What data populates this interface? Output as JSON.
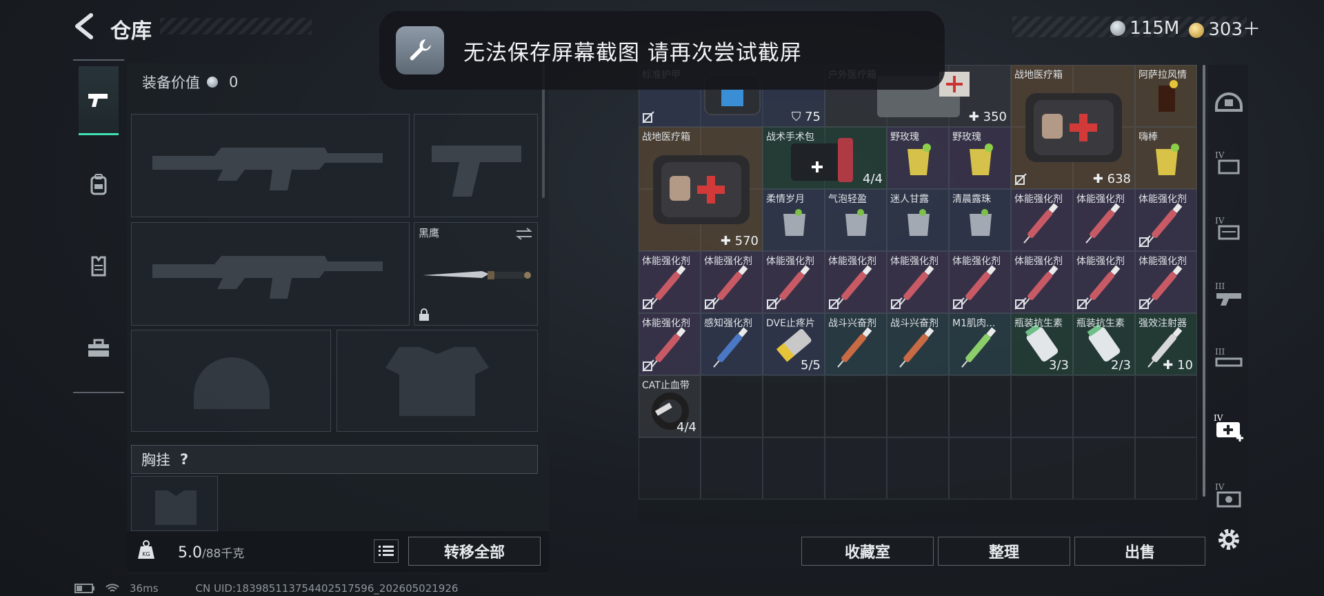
{
  "header": {
    "title": "仓库",
    "currency_silver": "115M",
    "currency_gold": "303＋"
  },
  "toast": {
    "message": "无法保存屏幕截图 请再次尝试截屏"
  },
  "equipment": {
    "value_label": "装备价值",
    "value": "0",
    "melee_name": "黑鹰",
    "chest_label": "胸挂",
    "chest_help": "?",
    "weight_current": "5.0",
    "weight_max": "/88千克",
    "transfer_all": "转移全部"
  },
  "storage": {
    "items": [
      {
        "name": "标准护甲",
        "count": "75",
        "count_icon": "shield"
      },
      {
        "name": "户外医疗箱",
        "count": "350",
        "count_icon": "plus"
      },
      {
        "name": "战地医疗箱",
        "count": "638",
        "count_icon": "plus"
      },
      {
        "name": "阿萨拉风情",
        "count": ""
      },
      {
        "name": "战地医疗箱",
        "count": "570",
        "count_icon": "plus"
      },
      {
        "name": "战术手术包",
        "count": "4/4"
      },
      {
        "name": "野玫瑰",
        "count": ""
      },
      {
        "name": "野玫瑰",
        "count": ""
      },
      {
        "name": "嗨棒",
        "count": ""
      },
      {
        "name": "柔情岁月",
        "count": ""
      },
      {
        "name": "气泡轻盈",
        "count": ""
      },
      {
        "name": "迷人甘露",
        "count": ""
      },
      {
        "name": "清晨露珠",
        "count": ""
      },
      {
        "name": "体能强化剂",
        "count": ""
      },
      {
        "name": "体能强化剂",
        "count": ""
      },
      {
        "name": "体能强化剂",
        "count": ""
      },
      {
        "name": "体能强化剂",
        "count": ""
      },
      {
        "name": "体能强化剂",
        "count": ""
      },
      {
        "name": "体能强化剂",
        "count": ""
      },
      {
        "name": "体能强化剂",
        "count": ""
      },
      {
        "name": "体能强化剂",
        "count": ""
      },
      {
        "name": "体能强化剂",
        "count": ""
      },
      {
        "name": "体能强化剂",
        "count": ""
      },
      {
        "name": "体能强化剂",
        "count": ""
      },
      {
        "name": "体能强化剂",
        "count": ""
      },
      {
        "name": "体能强化剂",
        "count": ""
      },
      {
        "name": "感知强化剂",
        "count": ""
      },
      {
        "name": "DVE止疼片",
        "count": "5/5"
      },
      {
        "name": "战斗兴奋剂",
        "count": ""
      },
      {
        "name": "战斗兴奋剂",
        "count": ""
      },
      {
        "name": "M1肌肉...",
        "count": ""
      },
      {
        "name": "瓶装抗生素",
        "count": "3/3"
      },
      {
        "name": "瓶装抗生素",
        "count": "2/3"
      },
      {
        "name": "强效注射器",
        "count": "10",
        "count_icon": "plus"
      },
      {
        "name": "CAT止血带",
        "count": "4/4"
      }
    ],
    "buttons": {
      "vault": "收藏室",
      "sort": "整理",
      "sell": "出售"
    }
  },
  "status": {
    "ping": "36ms",
    "uid": "CN UID:183985113754402517596_202605021926"
  },
  "colors": {
    "accent": "#3fe0b4",
    "medic_red": "#d23a3a"
  },
  "icons": {
    "back": "chevron-left-icon",
    "filters": [
      "pistol-icon",
      "backpack-icon",
      "vest-icon",
      "toolbox-icon"
    ],
    "right_filters": [
      "helmet-icon",
      "armor-tier4-icon",
      "armor-tier4b-icon",
      "gun-tier3-icon",
      "gun-tier3b-icon",
      "medkit-tier4-icon",
      "device-tier4-icon",
      "settings-gear-icon"
    ]
  }
}
